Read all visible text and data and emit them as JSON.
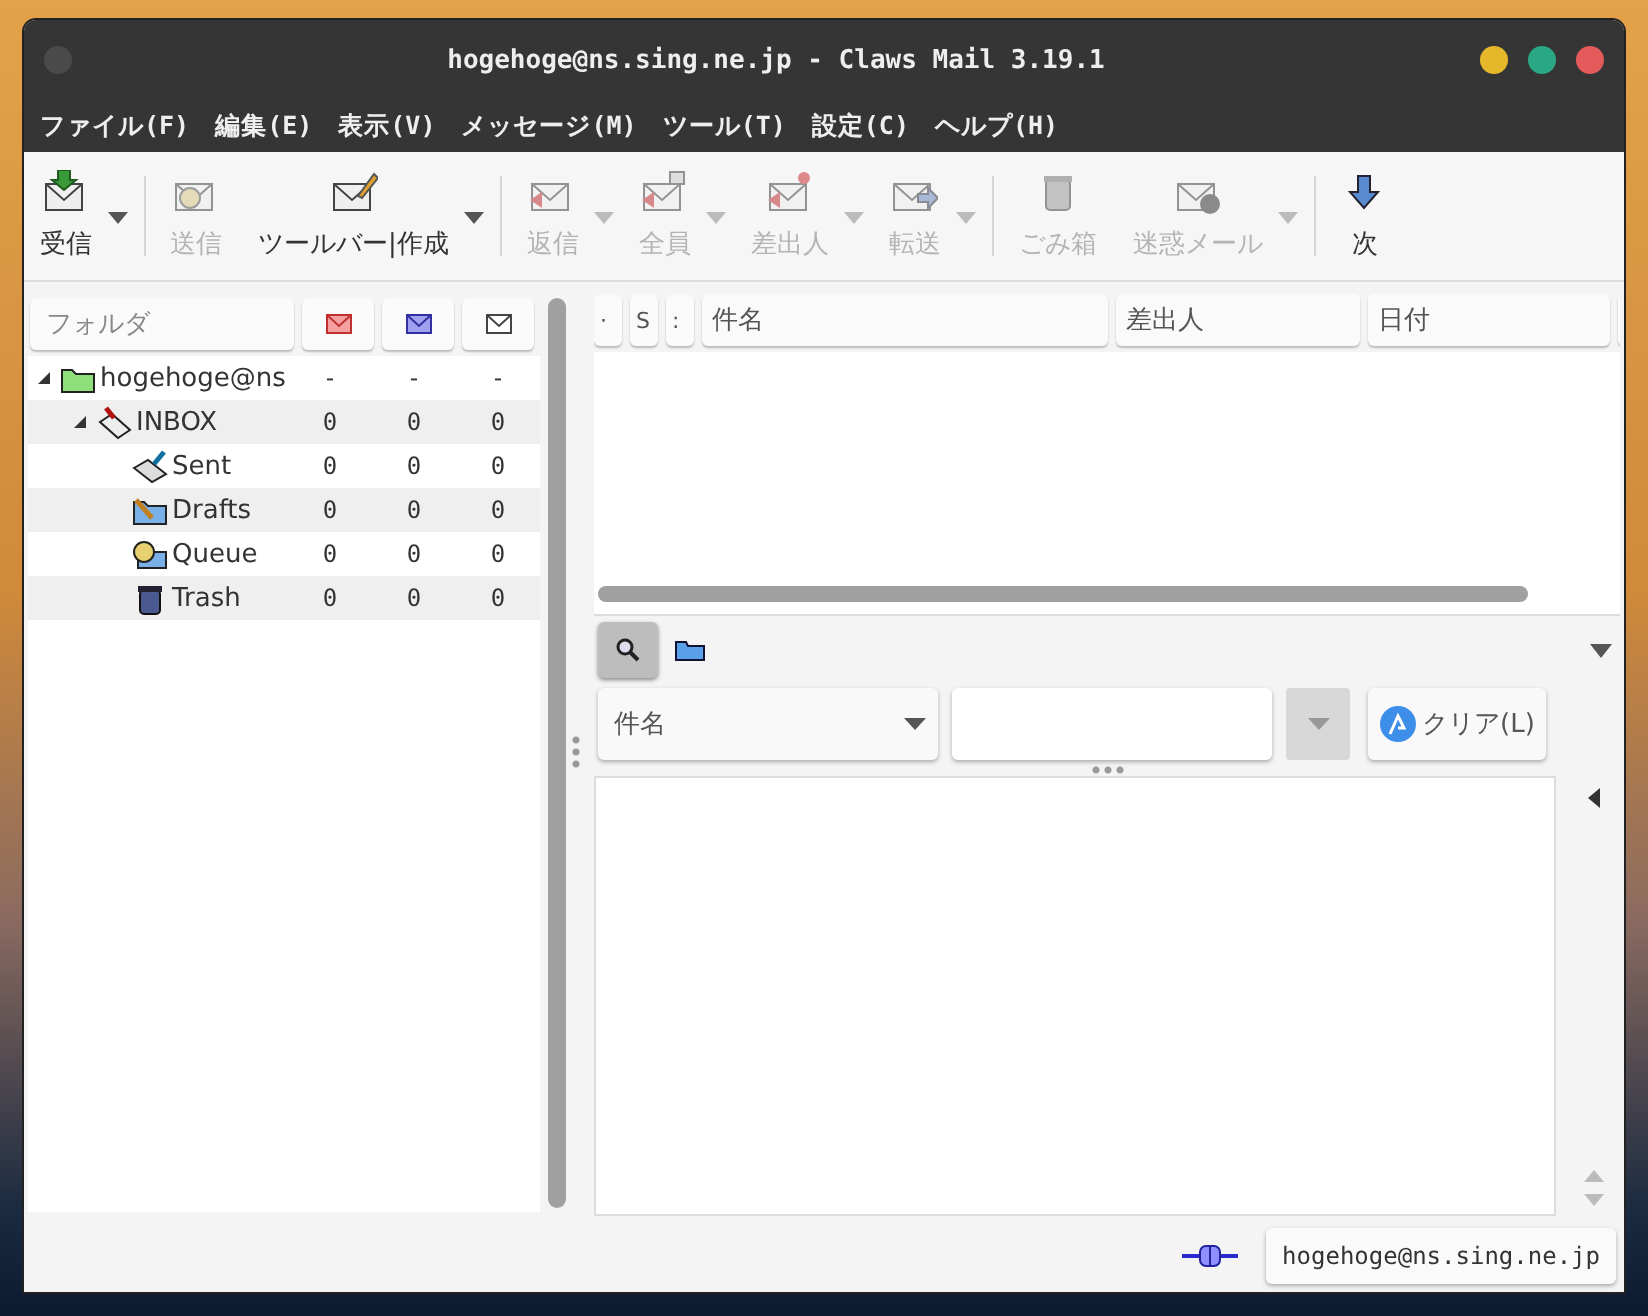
{
  "window": {
    "title": "hogehoge@ns.sing.ne.jp - Claws Mail 3.19.1"
  },
  "menu": [
    "ファイル(F)",
    "編集(E)",
    "表示(V)",
    "メッセージ(M)",
    "ツール(T)",
    "設定(C)",
    "ヘルプ(H)"
  ],
  "toolbar": [
    {
      "kind": "button",
      "label": "受信",
      "disabled": false,
      "dropdown": true
    },
    {
      "kind": "separator"
    },
    {
      "kind": "button",
      "label": "送信",
      "disabled": true,
      "dropdown": false
    },
    {
      "kind": "button",
      "label": "ツールバー|作成",
      "disabled": false,
      "dropdown": true
    },
    {
      "kind": "separator"
    },
    {
      "kind": "button",
      "label": "返信",
      "disabled": true,
      "dropdown": true
    },
    {
      "kind": "button",
      "label": "全員",
      "disabled": true,
      "dropdown": true
    },
    {
      "kind": "button",
      "label": "差出人",
      "disabled": true,
      "dropdown": true
    },
    {
      "kind": "button",
      "label": "転送",
      "disabled": true,
      "dropdown": true
    },
    {
      "kind": "separator"
    },
    {
      "kind": "button",
      "label": "ごみ箱",
      "disabled": true,
      "dropdown": false
    },
    {
      "kind": "button",
      "label": "迷惑メール",
      "disabled": true,
      "dropdown": true
    },
    {
      "kind": "separator"
    },
    {
      "kind": "button",
      "label": "次",
      "disabled": false,
      "dropdown": false
    }
  ],
  "folders": {
    "columns": [
      "フォルダ"
    ],
    "tree": [
      {
        "name": "hogehoge@ns",
        "new": "-",
        "unread": "-",
        "total": "-",
        "expanded": true,
        "children": [
          {
            "name": "INBOX",
            "new": "0",
            "unread": "0",
            "total": "0",
            "expanded": true,
            "children": [
              {
                "name": "Sent",
                "new": "0",
                "unread": "0",
                "total": "0"
              },
              {
                "name": "Drafts",
                "new": "0",
                "unread": "0",
                "total": "0"
              },
              {
                "name": "Queue",
                "new": "0",
                "unread": "0",
                "total": "0"
              },
              {
                "name": "Trash",
                "new": "0",
                "unread": "0",
                "total": "0"
              }
            ]
          }
        ]
      }
    ]
  },
  "messages": {
    "columns": [
      "·",
      "S",
      ":",
      "件名",
      "差出人",
      "日付"
    ]
  },
  "quick_search": {
    "toggle_selected": true,
    "field_combo": "件名",
    "clear_button": "クリア(L)"
  },
  "status_bar": {
    "account": "hogehoge@ns.sing.ne.jp"
  }
}
